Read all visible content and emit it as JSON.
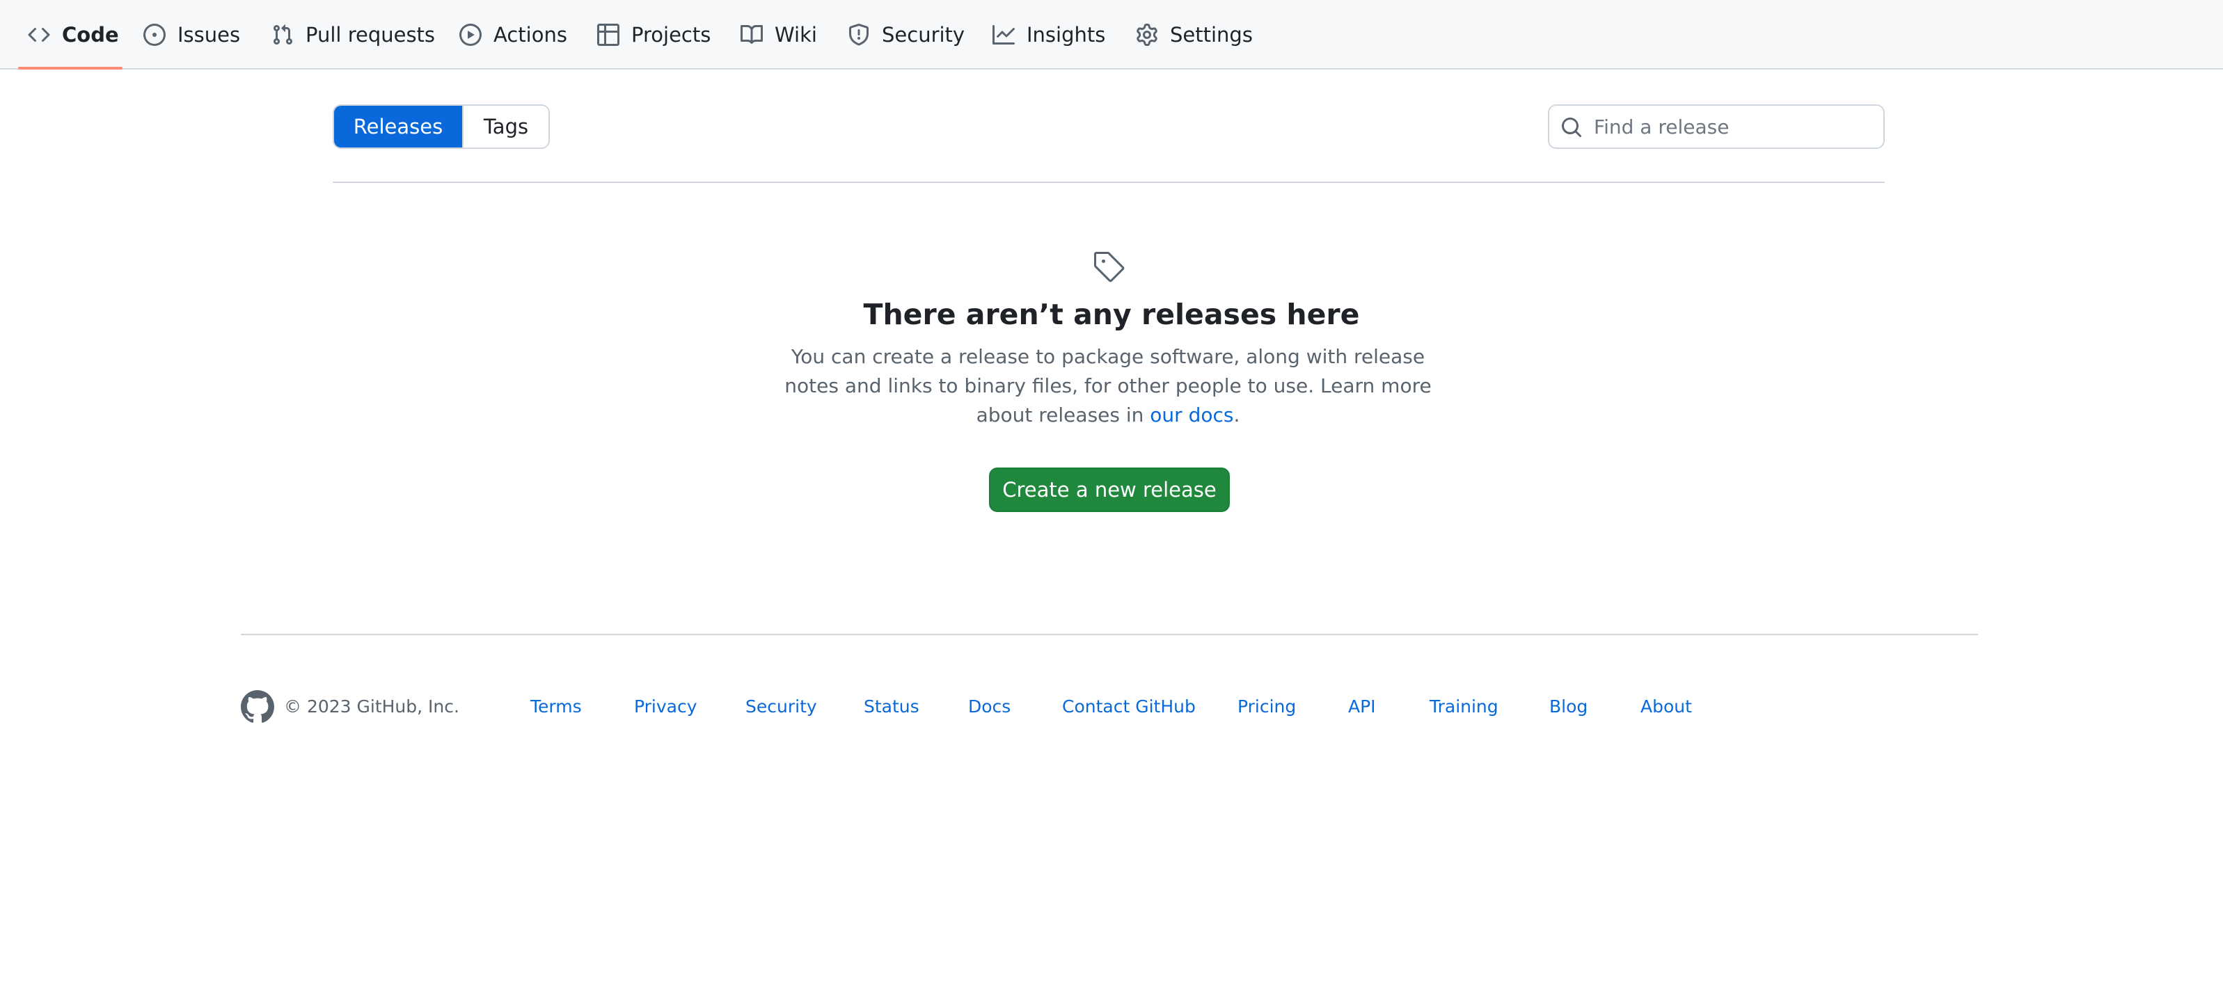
{
  "repo_nav": {
    "tabs": [
      {
        "label": "Code",
        "icon": "code-icon",
        "selected": true
      },
      {
        "label": "Issues",
        "icon": "issue-opened-icon"
      },
      {
        "label": "Pull requests",
        "icon": "git-pull-request-icon"
      },
      {
        "label": "Actions",
        "icon": "play-icon"
      },
      {
        "label": "Projects",
        "icon": "table-icon"
      },
      {
        "label": "Wiki",
        "icon": "book-icon"
      },
      {
        "label": "Security",
        "icon": "shield-icon"
      },
      {
        "label": "Insights",
        "icon": "graph-icon"
      },
      {
        "label": "Settings",
        "icon": "gear-icon"
      }
    ]
  },
  "subnav": {
    "releases_label": "Releases",
    "tags_label": "Tags",
    "active": "Releases"
  },
  "search": {
    "placeholder": "Find a release",
    "value": "",
    "icon": "search-icon"
  },
  "blankslate": {
    "icon": "tag-icon",
    "title": "There aren’t any releases here",
    "description_before": "You can create a release to package software, along with release notes and links to binary files, for other people to use. Learn more about releases in ",
    "docs_link": "our docs",
    "description_after": ".",
    "button_label": "Create a new release"
  },
  "footer": {
    "logo_icon": "github-mark-icon",
    "copyright": "© 2023 GitHub, Inc.",
    "links": [
      "Terms",
      "Privacy",
      "Security",
      "Status",
      "Docs",
      "Contact GitHub",
      "Pricing",
      "API",
      "Training",
      "Blog",
      "About"
    ]
  },
  "colors": {
    "accent": "#0969da",
    "primary_button": "#1f883d",
    "selected_tab_underline": "#fd8c73",
    "border": "#d0d7de",
    "muted_text": "#59636e"
  }
}
